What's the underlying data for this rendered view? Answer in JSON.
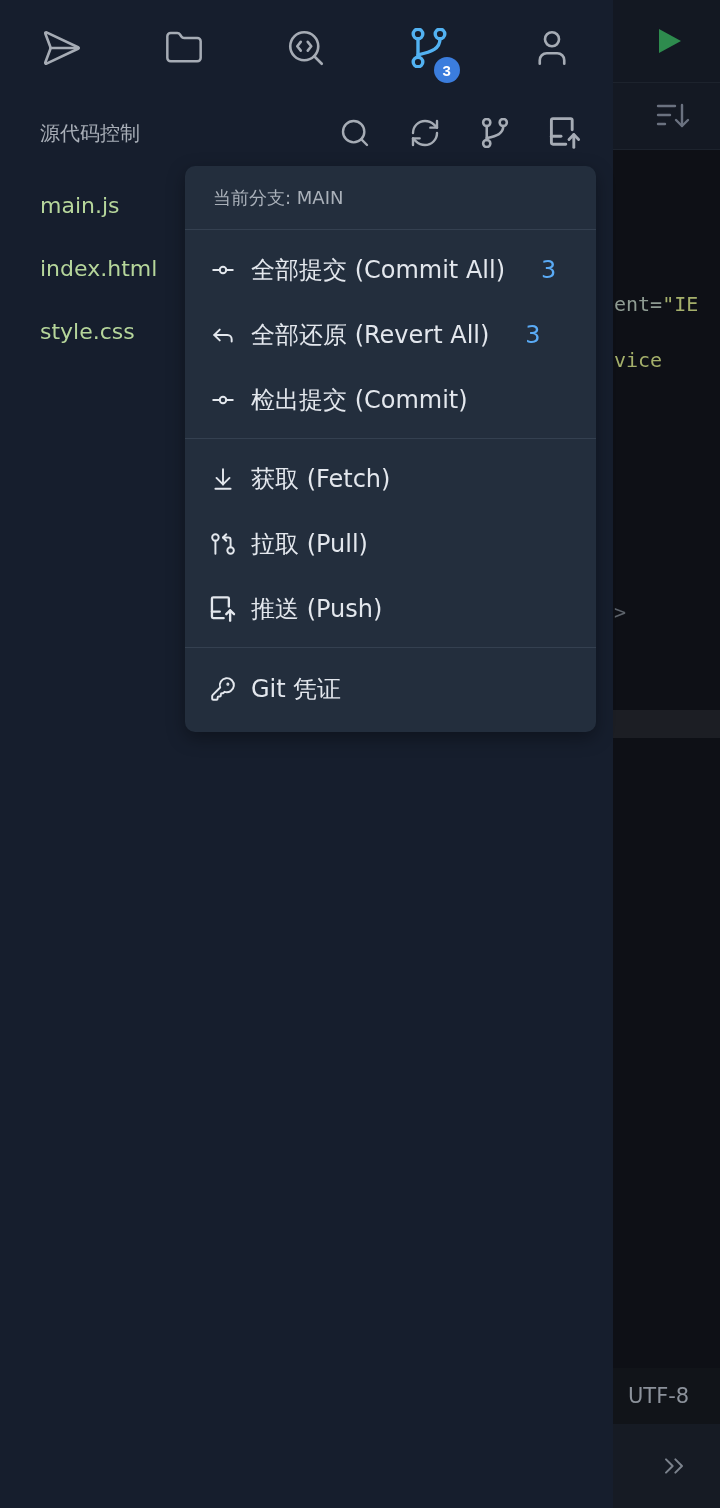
{
  "activity_bar": {
    "items": [
      {
        "kind": "send",
        "selected": false
      },
      {
        "kind": "files",
        "selected": false
      },
      {
        "kind": "code-search",
        "selected": false
      },
      {
        "kind": "source-control",
        "selected": true,
        "badge": "3"
      },
      {
        "kind": "account",
        "selected": false
      }
    ]
  },
  "panel": {
    "title": "源代码控制",
    "actions": [
      {
        "kind": "search"
      },
      {
        "kind": "refresh"
      },
      {
        "kind": "branch"
      },
      {
        "kind": "push"
      }
    ]
  },
  "changed_files": [
    {
      "name": "main.js"
    },
    {
      "name": "index.html"
    },
    {
      "name": "style.css"
    }
  ],
  "git_menu": {
    "header": "当前分支: MAIN",
    "groups": [
      {
        "items": [
          {
            "kind": "commit",
            "label": "全部提交 (Commit All)",
            "count": "3"
          },
          {
            "kind": "revert",
            "label": "全部还原 (Revert All)",
            "count": "3"
          },
          {
            "kind": "checkout",
            "label": "检出提交 (Commit)"
          }
        ]
      },
      {
        "items": [
          {
            "kind": "fetch",
            "label": "获取 (Fetch)"
          },
          {
            "kind": "pull",
            "label": "拉取 (Pull)"
          },
          {
            "kind": "push",
            "label": "推送 (Push)"
          }
        ]
      },
      {
        "items": [
          {
            "kind": "credentials",
            "label": "Git 凭证"
          }
        ]
      }
    ]
  },
  "editor": {
    "code_lines": [
      {
        "tokens": [
          {
            "text": "ent=",
            "kind": "attr"
          },
          {
            "text": "\"IE",
            "kind": "string"
          }
        ],
        "current": false
      },
      {
        "tokens": [
          {
            "text": "vice",
            "kind": "string"
          }
        ],
        "current": false
      },
      {
        "tokens": [
          {
            "text": ">",
            "kind": "punct"
          }
        ],
        "current": false
      },
      {
        "current": true
      }
    ],
    "encoding": "UTF-8"
  }
}
